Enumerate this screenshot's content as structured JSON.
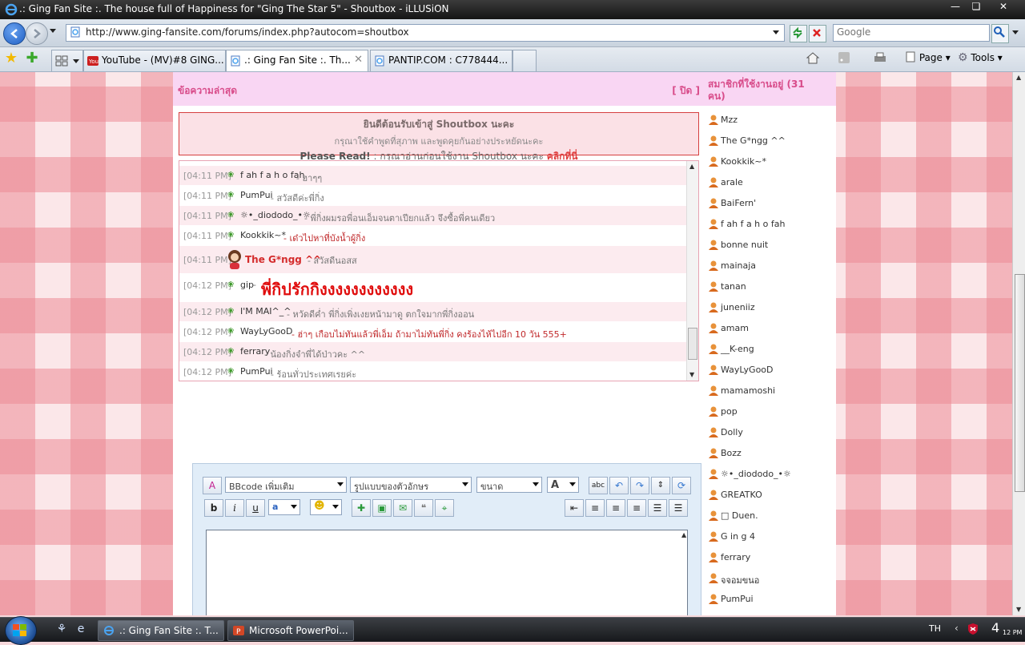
{
  "window": {
    "title": ".: Ging Fan Site :. The house full of Happiness for \"Ging The Star 5\" - Shoutbox - iLLUSiON"
  },
  "browser": {
    "url": "http://www.ging-fansite.com/forums/index.php?autocom=shoutbox",
    "search_placeholder": "Google",
    "tabs": [
      {
        "label": "YouTube - (MV)#8 GING...",
        "icon": "youtube-icon"
      },
      {
        "label": ".: Ging Fan Site :. Th...",
        "icon": "ie-page-icon",
        "active": true
      },
      {
        "label": "PANTIP.COM : C778444...",
        "icon": "ie-page-icon"
      }
    ],
    "commands": {
      "page": "Page",
      "tools": "Tools"
    }
  },
  "shoutbox": {
    "latest_title": "ข้อความล่าสุด",
    "close_link": "[ ปิด ]",
    "welcome": {
      "line1": "ยินดีต้อนรับเข้าสู่ Shoutbox นะคะ",
      "line2": "กรุณาใช้คำพูดที่สุภาพ และพูดคุยกันอย่างประหยัดนะคะ",
      "line3_bold": "Please Read!",
      "line3_text": ": กรุณาอ่านก่อนใช้งาน Shoutbox นะคะ",
      "line3_link": "คลิกที่นี่"
    },
    "messages": [
      {
        "time": "[04:11 PM]",
        "user": "f ah f a h o fah",
        "sep": " - ",
        "text": "ฮาๆๆ"
      },
      {
        "time": "[04:11 PM]",
        "user": "PumPui",
        "sep": " - ",
        "text": "สวัสดีค่ะพี่กิ่ง"
      },
      {
        "time": "[04:11 PM]",
        "user": "☼•_diododo_•☼",
        "sep": " - ",
        "text": "พี่กิ่งผมรอพี่อนเอ็มจนตาเปียกแล้ว จึงซื้อพี่คนเดียว"
      },
      {
        "time": "[04:11 PM]",
        "user": "Kookkik~*",
        "sep": " - ",
        "text": "เด๋วไปหาที่บังน้ำผู้กิ่ง"
      },
      {
        "time": "[04:11 PM]",
        "user": "The G*ngg ^^",
        "sep": " - ",
        "text": "สวัสดีนอสส"
      },
      {
        "time": "[04:12 PM]",
        "user": "gip",
        "sep": " - ",
        "text": "พี่กิปรักกิงงงงงงงงงงงง"
      },
      {
        "time": "[04:12 PM]",
        "user": "I'M MAI^_^",
        "sep": " - ",
        "text": "หวัดดีค่ำ พี่กิ่งเพิ่งเงยหน้ามาดู ตกใจมากพี่กิ่งออน"
      },
      {
        "time": "[04:12 PM]",
        "user": "WayLyGooD",
        "sep": " - ",
        "text": "ฮ่าๆ เกือบไม่ทันแล้วพี่เอ็ม ถ้ามาไม่ทันพี่กิ่ง คงร้องไห้ไปอีก 10 วัน 555+"
      },
      {
        "time": "[04:12 PM]",
        "user": "ferrary",
        "sep": " - ",
        "text": "น้องกิ่งจำพี่ได้ป่าวคะ ^^"
      },
      {
        "time": "[04:12 PM]",
        "user": "PumPui",
        "sep": " - ",
        "text": "ร้อนทั่วประเทศเรยค่ะ"
      }
    ],
    "editor": {
      "bbcode_select": "BBcode เพิ่มเติม",
      "font_select": "รูปแบบของตัวอักษร",
      "size_select": "ขนาด",
      "bold": "b",
      "italic": "i",
      "underline": "u"
    }
  },
  "online": {
    "title": "สมาชิกที่ใช้งานอยู่ (31 คน)",
    "members": [
      "Mzz",
      "The G*ngg ^^",
      "Kookkik~*",
      "arale",
      "BaiFern'",
      "f ah f a h o fah",
      "bonne nuit",
      "mainaja",
      "tanan",
      "juneniiz",
      "amam",
      "__K-eng",
      "WayLyGooD",
      "mamamoshi",
      "pop",
      "Dolly",
      "Bozz",
      "☼•_diododo_•☼",
      "GREATKO",
      "□ Duen.",
      "G in g 4",
      "ferrary",
      "จจอมขนอ",
      "PumPui"
    ]
  },
  "taskbar": {
    "tasks": [
      {
        "label": ".: Ging Fan Site :. T...",
        "icon": "ie-icon"
      },
      {
        "label": "Microsoft PowerPoi...",
        "icon": "powerpoint-icon"
      }
    ],
    "language": "TH",
    "time": "4",
    "time_small": "12 PM"
  },
  "colors": {
    "accent_pink": "#d84c8a",
    "shout_red": "#c0282a",
    "gingham_pink": "#ec8c96"
  }
}
